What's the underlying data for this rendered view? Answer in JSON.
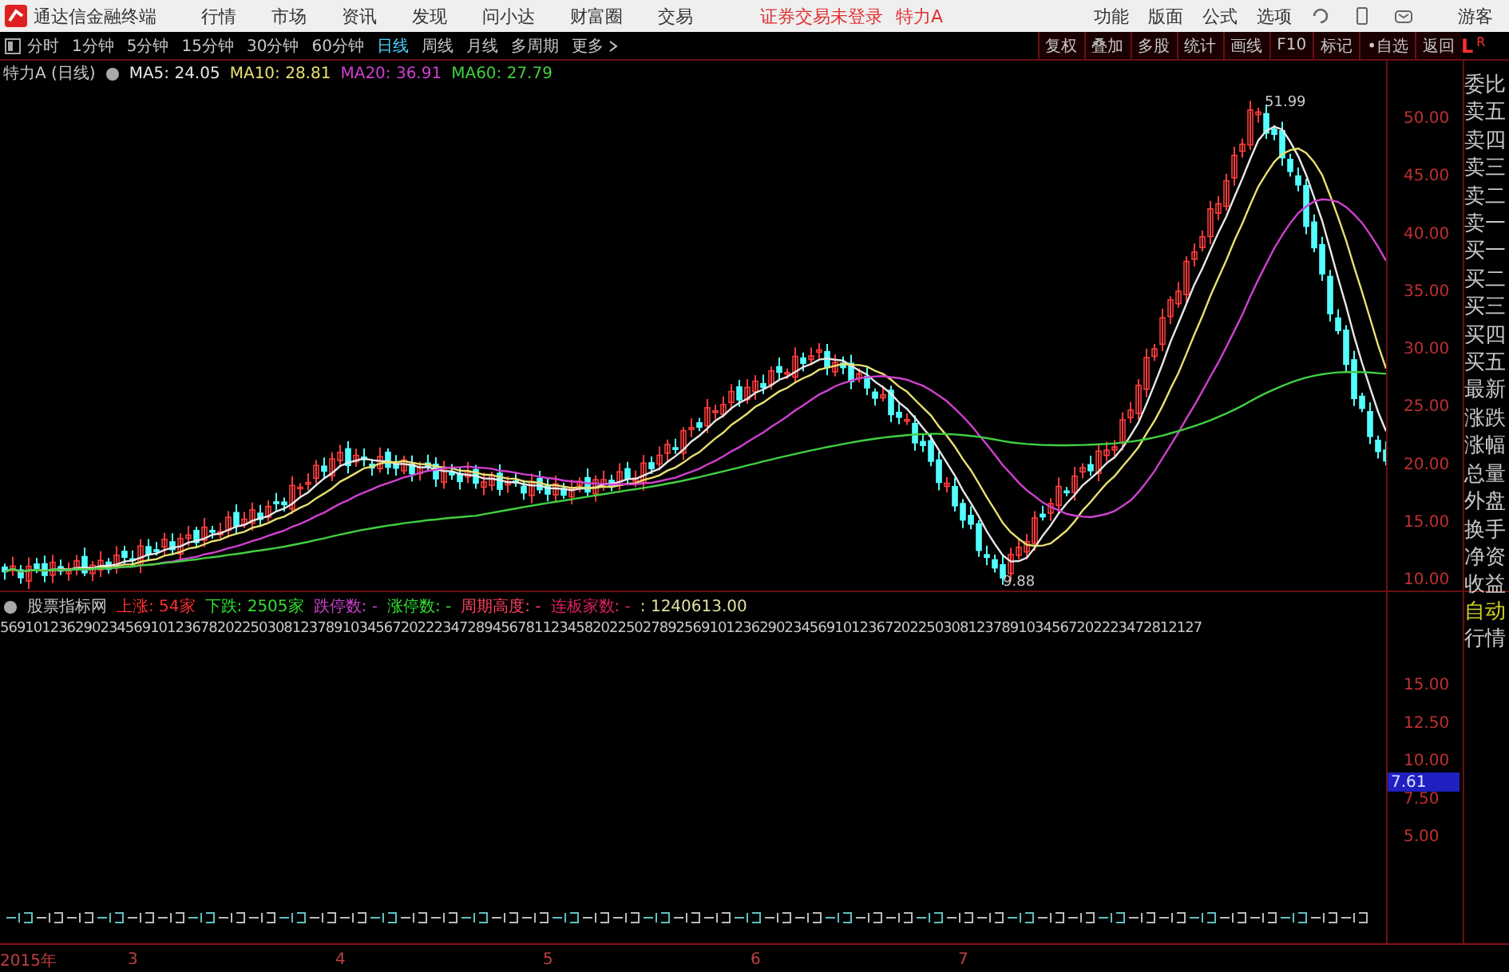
{
  "menu_bar": {
    "app_title": "通达信金融终端",
    "items": [
      "行情",
      "市场",
      "资讯",
      "发现",
      "问小达",
      "财富圈",
      "交易"
    ],
    "status": "证券交易未登录",
    "stock": "特力A",
    "right_items": [
      "功能",
      "版面",
      "公式",
      "选项"
    ],
    "user": "游客"
  },
  "period_tabs": [
    {
      "label": "分时",
      "selected": false
    },
    {
      "label": "1分钟",
      "selected": false
    },
    {
      "label": "5分钟",
      "selected": false
    },
    {
      "label": "15分钟",
      "selected": false
    },
    {
      "label": "30分钟",
      "selected": false
    },
    {
      "label": "60分钟",
      "selected": false
    },
    {
      "label": "日线",
      "selected": true
    },
    {
      "label": "周线",
      "selected": false
    },
    {
      "label": "月线",
      "selected": false
    },
    {
      "label": "多周期",
      "selected": false
    },
    {
      "label": "更多",
      "selected": false
    }
  ],
  "tool_buttons": [
    "复权",
    "叠加",
    "多股",
    "统计",
    "画线",
    "F10",
    "标记",
    "•自选",
    "返回"
  ],
  "corner": {
    "left": "L",
    "right": "R"
  },
  "chart": {
    "title": "特力A (日线)",
    "ma": [
      {
        "label": "MA5: 24.05",
        "color": "#e8e8e8"
      },
      {
        "label": "MA10: 28.81",
        "color": "#e8e070"
      },
      {
        "label": "MA20: 36.91",
        "color": "#d040d0"
      },
      {
        "label": "MA60: 27.79",
        "color": "#40d040"
      }
    ],
    "high_label": "51.99",
    "low_label": "9.88",
    "price_ticks": [
      "50.00",
      "45.00",
      "40.00",
      "35.00",
      "30.00",
      "25.00",
      "20.00",
      "15.00",
      "10.00"
    ]
  },
  "side_panel": {
    "items": [
      "委比",
      "卖五",
      "卖四",
      "卖三",
      "卖二",
      "卖一",
      "买一",
      "买二",
      "买三",
      "买四",
      "买五",
      "最新",
      "涨跌",
      "涨幅",
      "总量",
      "外盘",
      "换手",
      "净资",
      "收益"
    ],
    "bottom_items": [
      "自动",
      "行情"
    ]
  },
  "indicator": {
    "title": "股票指标网",
    "stats": [
      {
        "label": "上涨: 54家",
        "color": "#ff3030"
      },
      {
        "label": "下跌: 2505家",
        "color": "#30e030"
      },
      {
        "label": "跌停数: -",
        "color": "#d040d0"
      },
      {
        "label": "涨停数: -",
        "color": "#30e030"
      },
      {
        "label": "周期高度: -",
        "color": "#ff4060"
      },
      {
        "label": "连板家数: -",
        "color": "#e02060"
      },
      {
        "label": ": 1240613.00",
        "color": "#e0e0a0"
      }
    ],
    "digits": "569101236290234569101236782022503081237891034567202223472894567811234582022502789256910123629023456910123672022503081237891034567202223472812127",
    "ticks": [
      "15.00",
      "12.50",
      "10.00",
      "7.50",
      "5.00"
    ],
    "current": "7.61"
  },
  "date_axis": [
    "2015年",
    "3",
    "4",
    "5",
    "6",
    "7"
  ]
}
